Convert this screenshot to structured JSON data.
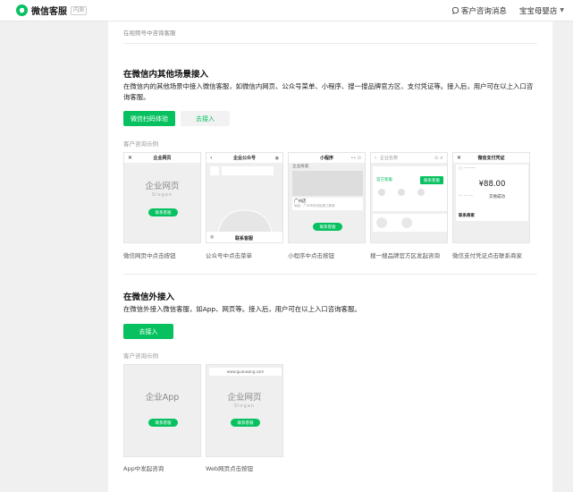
{
  "header": {
    "app_name": "微信客服",
    "beta_tag": "内测",
    "messages": "客户咨询消息",
    "store": "宝宝母婴店"
  },
  "top_tip": "在视频号中咨询客服",
  "section_in": {
    "title": "在微信内其他场景接入",
    "desc": "在微信内的其他场景中接入微信客服，如微信内网页、公众号菜单、小程序、搜一搜品牌官方区、支付凭证等。接入后，用户可在以上入口咨询客服。",
    "btn_scan": "微信扫码体验",
    "btn_access": "去接入",
    "examples_label": "客户咨询示例",
    "previews": [
      {
        "bar": "企业网页",
        "caption": "微信网页中点击按钮",
        "big": "企业网页",
        "slogan": "Slogan",
        "btn": "联系客服"
      },
      {
        "bar": "企业公众号",
        "caption": "公众号中点击菜单",
        "menu": "联系客服"
      },
      {
        "bar": "小程序",
        "caption": "小程序中点击按钮",
        "title": "企业商城",
        "city": "广州店",
        "addr": "地址：广州市天河区珠江新城",
        "btn": "联系客服"
      },
      {
        "bar": "企业名称",
        "caption": "搜一搜品牌官方区发起咨询",
        "link": "官方客服",
        "btn": "联系客服"
      },
      {
        "bar": "微信支付凭证",
        "caption": "微信支付凭证点击联系商家",
        "amount": "¥88.00",
        "status": "交易成功",
        "link": "联系商家"
      }
    ]
  },
  "section_out": {
    "title": "在微信外接入",
    "desc": "在微信外接入微信客服，如App、网页等。接入后，用户可在以上入口咨询客服。",
    "btn_access": "去接入",
    "examples_label": "客户咨询示例",
    "previews": [
      {
        "caption": "App中发起咨询",
        "big": "企业App",
        "btn": "联系客服"
      },
      {
        "caption": "Web网页点击按钮",
        "url": "www.guanwang.com",
        "big": "企业网页",
        "slogan": "Slogan",
        "btn": "联系客服"
      }
    ]
  },
  "colors": {
    "accent": "#07c160"
  }
}
